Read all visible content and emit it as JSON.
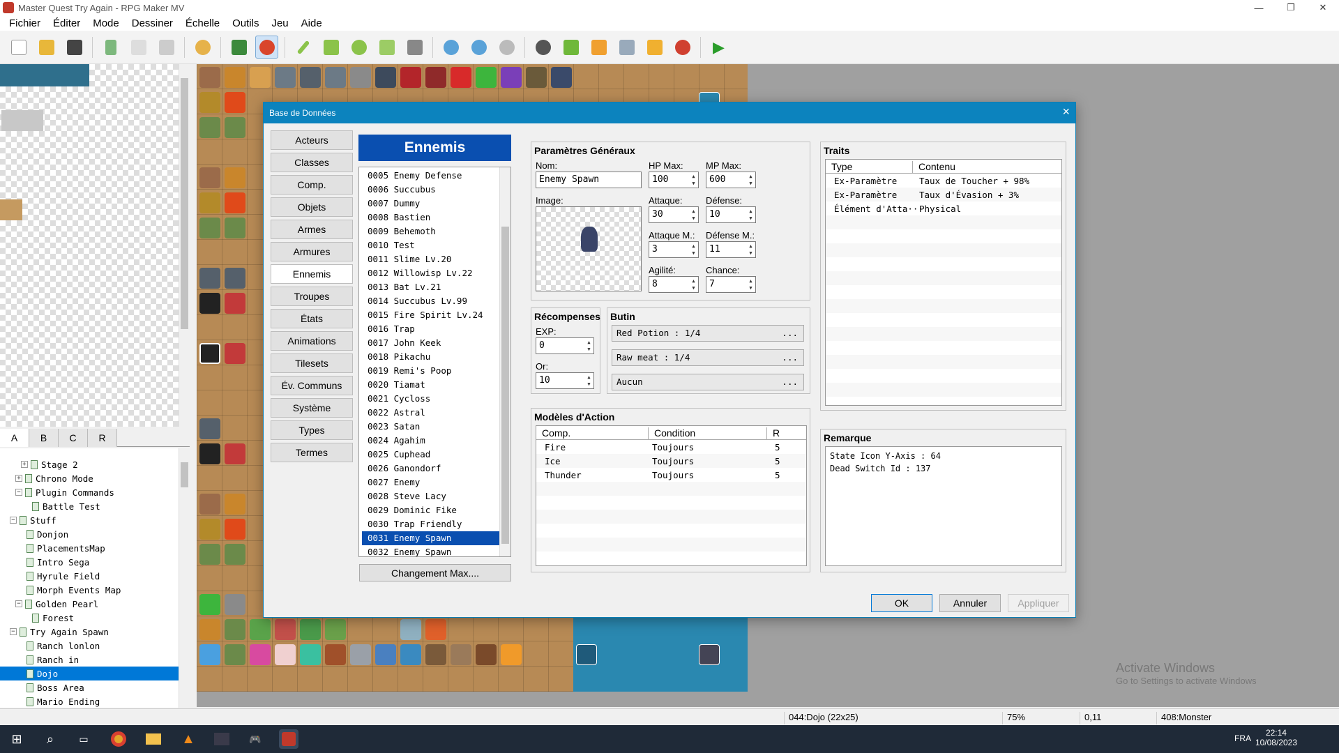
{
  "window": {
    "title": "Master Quest Try Again - RPG Maker MV"
  },
  "menu": [
    "Fichier",
    "Éditer",
    "Mode",
    "Dessiner",
    "Échelle",
    "Outils",
    "Jeu",
    "Aide"
  ],
  "tileset_tabs": [
    "A",
    "B",
    "C",
    "R"
  ],
  "map_tree": [
    {
      "label": "Stage 2",
      "toggle": "+"
    },
    {
      "label": "Chrono Mode",
      "toggle": "+"
    },
    {
      "label": "Plugin Commands",
      "toggle": "−"
    },
    {
      "label": "Battle Test",
      "toggle": ""
    },
    {
      "label": "Stuff",
      "toggle": "−"
    },
    {
      "label": "Donjon",
      "toggle": ""
    },
    {
      "label": "PlacementsMap",
      "toggle": ""
    },
    {
      "label": "Intro Sega",
      "toggle": ""
    },
    {
      "label": "Hyrule Field",
      "toggle": ""
    },
    {
      "label": "Morph Events Map",
      "toggle": ""
    },
    {
      "label": "Golden Pearl",
      "toggle": "−"
    },
    {
      "label": "Forest",
      "toggle": ""
    },
    {
      "label": "Try Again Spawn",
      "toggle": "−"
    },
    {
      "label": "Ranch lonlon",
      "toggle": ""
    },
    {
      "label": "Ranch in",
      "toggle": ""
    },
    {
      "label": "Dojo",
      "toggle": ""
    },
    {
      "label": "Boss Area",
      "toggle": ""
    },
    {
      "label": "Mario Ending",
      "toggle": ""
    }
  ],
  "dialog": {
    "title": "Base de Données",
    "close": "×",
    "categories": [
      "Acteurs",
      "Classes",
      "Comp.",
      "Objets",
      "Armes",
      "Armures",
      "Ennemis",
      "Troupes",
      "États",
      "Animations",
      "Tilesets",
      "Év. Communs",
      "Système",
      "Types",
      "Termes"
    ],
    "list_header": "Ennemis",
    "enemies": [
      "0005 Enemy Defense",
      "0006 Succubus",
      "0007 Dummy",
      "0008 Bastien",
      "0009 Behemoth",
      "0010 Test",
      "0011 Slime Lv.20",
      "0012 Willowisp Lv.22",
      "0013 Bat Lv.21",
      "0014 Succubus Lv.99",
      "0015 Fire Spirit Lv.24",
      "0016 Trap",
      "0017 John Keek",
      "0018 Pikachu",
      "0019 Remi's Poop",
      "0020 Tiamat",
      "0021 Cycloss",
      "0022 Astral",
      "0023 Satan",
      "0024 Agahim",
      "0025 Cuphead",
      "0026 Ganondorf",
      "0027 Enemy",
      "0028 Steve Lacy",
      "0029 Dominic Fike",
      "0030 Trap Friendly",
      "0031 Enemy Spawn",
      "0032 Enemy Spawn"
    ],
    "change_max": "Changement Max....",
    "general": {
      "header": "Paramètres Généraux",
      "name_label": "Nom:",
      "name_value": "Enemy Spawn",
      "image_label": "Image:",
      "hp_label": "HP Max:",
      "hp": "100",
      "mp_label": "MP Max:",
      "mp": "600",
      "atk_label": "Attaque:",
      "atk": "30",
      "def_label": "Défense:",
      "def": "10",
      "matk_label": "Attaque M.:",
      "matk": "3",
      "mdef_label": "Défense M.:",
      "mdef": "11",
      "agi_label": "Agilité:",
      "agi": "8",
      "luk_label": "Chance:",
      "luk": "7"
    },
    "rewards": {
      "header": "Récompenses",
      "exp_label": "EXP:",
      "exp": "0",
      "gold_label": "Or:",
      "gold": "10"
    },
    "drops": {
      "header": "Butin",
      "items": [
        "Red Potion : 1/4",
        "Raw meat : 1/4",
        "Aucun"
      ],
      "more": "..."
    },
    "actions": {
      "header": "Modèles d'Action",
      "columns": [
        "Comp.",
        "Condition",
        "R"
      ],
      "rows": [
        [
          "Fire",
          "Toujours",
          "5"
        ],
        [
          "Ice",
          "Toujours",
          "5"
        ],
        [
          "Thunder",
          "Toujours",
          "5"
        ]
      ]
    },
    "traits": {
      "header": "Traits",
      "columns": [
        "Type",
        "Contenu"
      ],
      "rows": [
        [
          "Ex-Paramètre",
          "Taux de Toucher + 98%"
        ],
        [
          "Ex-Paramètre",
          "Taux d'Évasion + 3%"
        ],
        [
          "Élément d'Atta···",
          "Physical"
        ]
      ]
    },
    "note": {
      "header": "Remarque",
      "lines": [
        "State Icon Y-Axis : 64",
        "Dead Switch Id : 137"
      ]
    },
    "buttons": {
      "ok": "OK",
      "cancel": "Annuler",
      "apply": "Appliquer"
    }
  },
  "statusbar": {
    "map": "044:Dojo (22x25)",
    "zoom": "75%",
    "coords": "0,11",
    "event": "408:Monster"
  },
  "watermark": {
    "line1": "Activate Windows",
    "line2": "Go to Settings to activate Windows"
  },
  "taskbar": {
    "lang": "FRA",
    "time": "22:14",
    "date": "10/08/2023"
  },
  "colors": {
    "accent": "#0c83be",
    "selection": "#0a4fb0"
  }
}
